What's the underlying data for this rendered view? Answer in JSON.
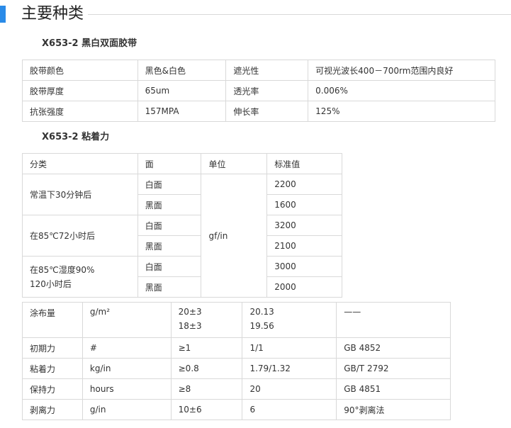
{
  "section_title": "主要种类",
  "spec_title": "X653-2 黑白双面胶带",
  "spec_rows": [
    [
      "胶带颜色",
      "黑色&白色",
      "遮光性",
      "可视光波长400－700rm范围内良好"
    ],
    [
      "胶带厚度",
      "65um",
      "透光率",
      "0.006%"
    ],
    [
      "抗张强度",
      "157MPA",
      "伸长率",
      "125%"
    ]
  ],
  "adhesion_title": "X653-2 粘着力",
  "adhesion": {
    "headers": [
      "分类",
      "面",
      "单位",
      "标准值"
    ],
    "unit": "gf/in",
    "groups": [
      {
        "label_lines": [
          "常温下30分钟后"
        ],
        "rows": [
          [
            "白面",
            "2200"
          ],
          [
            "黑面",
            "1600"
          ]
        ]
      },
      {
        "label_lines": [
          "在85℃72小时后"
        ],
        "rows": [
          [
            "白面",
            "3200"
          ],
          [
            "黑面",
            "2100"
          ]
        ]
      },
      {
        "label_lines": [
          "在85℃湿度90%",
          "120小时后"
        ],
        "rows": [
          [
            "白面",
            "3000"
          ],
          [
            "黑面",
            "2000"
          ]
        ]
      }
    ]
  },
  "props": {
    "coating": {
      "name": "涂布量",
      "unit": "g/m²",
      "spec_lines": [
        "20±3",
        "18±3"
      ],
      "value_lines": [
        "20.13",
        "19.56"
      ],
      "method": "——"
    },
    "rows": [
      [
        "初期力",
        "#",
        "≥1",
        "1/1",
        "GB 4852"
      ],
      [
        "粘着力",
        "kg/in",
        "≥0.8",
        "1.79/1.32",
        "GB/T 2792"
      ],
      [
        "保持力",
        "hours",
        "≥8",
        "20",
        "GB 4851"
      ],
      [
        "剥离力",
        "g/in",
        "10±6",
        "6",
        "90°剥离法"
      ]
    ]
  }
}
